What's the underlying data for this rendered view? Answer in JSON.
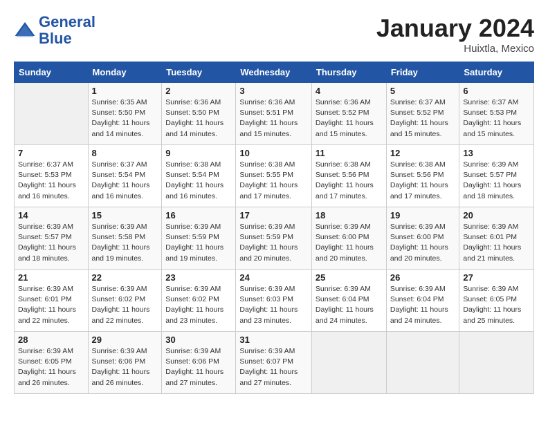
{
  "header": {
    "logo_line1": "General",
    "logo_line2": "Blue",
    "month": "January 2024",
    "location": "Huixtla, Mexico"
  },
  "weekdays": [
    "Sunday",
    "Monday",
    "Tuesday",
    "Wednesday",
    "Thursday",
    "Friday",
    "Saturday"
  ],
  "weeks": [
    [
      {
        "day": "",
        "info": ""
      },
      {
        "day": "1",
        "info": "Sunrise: 6:35 AM\nSunset: 5:50 PM\nDaylight: 11 hours\nand 14 minutes."
      },
      {
        "day": "2",
        "info": "Sunrise: 6:36 AM\nSunset: 5:50 PM\nDaylight: 11 hours\nand 14 minutes."
      },
      {
        "day": "3",
        "info": "Sunrise: 6:36 AM\nSunset: 5:51 PM\nDaylight: 11 hours\nand 15 minutes."
      },
      {
        "day": "4",
        "info": "Sunrise: 6:36 AM\nSunset: 5:52 PM\nDaylight: 11 hours\nand 15 minutes."
      },
      {
        "day": "5",
        "info": "Sunrise: 6:37 AM\nSunset: 5:52 PM\nDaylight: 11 hours\nand 15 minutes."
      },
      {
        "day": "6",
        "info": "Sunrise: 6:37 AM\nSunset: 5:53 PM\nDaylight: 11 hours\nand 15 minutes."
      }
    ],
    [
      {
        "day": "7",
        "info": "Sunrise: 6:37 AM\nSunset: 5:53 PM\nDaylight: 11 hours\nand 16 minutes."
      },
      {
        "day": "8",
        "info": "Sunrise: 6:37 AM\nSunset: 5:54 PM\nDaylight: 11 hours\nand 16 minutes."
      },
      {
        "day": "9",
        "info": "Sunrise: 6:38 AM\nSunset: 5:54 PM\nDaylight: 11 hours\nand 16 minutes."
      },
      {
        "day": "10",
        "info": "Sunrise: 6:38 AM\nSunset: 5:55 PM\nDaylight: 11 hours\nand 17 minutes."
      },
      {
        "day": "11",
        "info": "Sunrise: 6:38 AM\nSunset: 5:56 PM\nDaylight: 11 hours\nand 17 minutes."
      },
      {
        "day": "12",
        "info": "Sunrise: 6:38 AM\nSunset: 5:56 PM\nDaylight: 11 hours\nand 17 minutes."
      },
      {
        "day": "13",
        "info": "Sunrise: 6:39 AM\nSunset: 5:57 PM\nDaylight: 11 hours\nand 18 minutes."
      }
    ],
    [
      {
        "day": "14",
        "info": "Sunrise: 6:39 AM\nSunset: 5:57 PM\nDaylight: 11 hours\nand 18 minutes."
      },
      {
        "day": "15",
        "info": "Sunrise: 6:39 AM\nSunset: 5:58 PM\nDaylight: 11 hours\nand 19 minutes."
      },
      {
        "day": "16",
        "info": "Sunrise: 6:39 AM\nSunset: 5:59 PM\nDaylight: 11 hours\nand 19 minutes."
      },
      {
        "day": "17",
        "info": "Sunrise: 6:39 AM\nSunset: 5:59 PM\nDaylight: 11 hours\nand 20 minutes."
      },
      {
        "day": "18",
        "info": "Sunrise: 6:39 AM\nSunset: 6:00 PM\nDaylight: 11 hours\nand 20 minutes."
      },
      {
        "day": "19",
        "info": "Sunrise: 6:39 AM\nSunset: 6:00 PM\nDaylight: 11 hours\nand 20 minutes."
      },
      {
        "day": "20",
        "info": "Sunrise: 6:39 AM\nSunset: 6:01 PM\nDaylight: 11 hours\nand 21 minutes."
      }
    ],
    [
      {
        "day": "21",
        "info": "Sunrise: 6:39 AM\nSunset: 6:01 PM\nDaylight: 11 hours\nand 22 minutes."
      },
      {
        "day": "22",
        "info": "Sunrise: 6:39 AM\nSunset: 6:02 PM\nDaylight: 11 hours\nand 22 minutes."
      },
      {
        "day": "23",
        "info": "Sunrise: 6:39 AM\nSunset: 6:02 PM\nDaylight: 11 hours\nand 23 minutes."
      },
      {
        "day": "24",
        "info": "Sunrise: 6:39 AM\nSunset: 6:03 PM\nDaylight: 11 hours\nand 23 minutes."
      },
      {
        "day": "25",
        "info": "Sunrise: 6:39 AM\nSunset: 6:04 PM\nDaylight: 11 hours\nand 24 minutes."
      },
      {
        "day": "26",
        "info": "Sunrise: 6:39 AM\nSunset: 6:04 PM\nDaylight: 11 hours\nand 24 minutes."
      },
      {
        "day": "27",
        "info": "Sunrise: 6:39 AM\nSunset: 6:05 PM\nDaylight: 11 hours\nand 25 minutes."
      }
    ],
    [
      {
        "day": "28",
        "info": "Sunrise: 6:39 AM\nSunset: 6:05 PM\nDaylight: 11 hours\nand 26 minutes."
      },
      {
        "day": "29",
        "info": "Sunrise: 6:39 AM\nSunset: 6:06 PM\nDaylight: 11 hours\nand 26 minutes."
      },
      {
        "day": "30",
        "info": "Sunrise: 6:39 AM\nSunset: 6:06 PM\nDaylight: 11 hours\nand 27 minutes."
      },
      {
        "day": "31",
        "info": "Sunrise: 6:39 AM\nSunset: 6:07 PM\nDaylight: 11 hours\nand 27 minutes."
      },
      {
        "day": "",
        "info": ""
      },
      {
        "day": "",
        "info": ""
      },
      {
        "day": "",
        "info": ""
      }
    ]
  ]
}
